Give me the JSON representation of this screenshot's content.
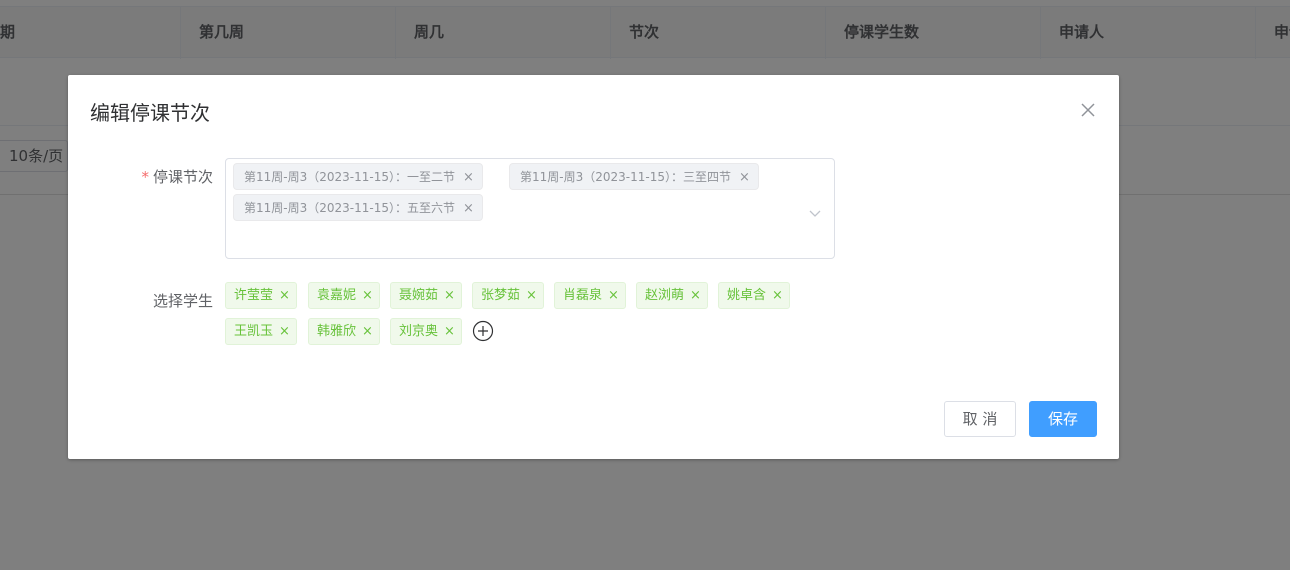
{
  "background": {
    "table_headers": [
      "期",
      "第几周",
      "周几",
      "节次",
      "停课学生数",
      "申请人",
      "申请"
    ],
    "page_size": "10条/页"
  },
  "dialog": {
    "title": "编辑停课节次",
    "close_icon": "close-icon",
    "form": {
      "periods_label": "停课节次",
      "required_mark": "*",
      "selected_periods": [
        "第11周-周3（2023-11-15）：一至二节",
        "第11周-周3（2023-11-15）：三至四节",
        "第11周-周3（2023-11-15）：五至六节"
      ],
      "students_label": "选择学生",
      "students": [
        "许莹莹",
        "袁嘉妮",
        "聂婉茹",
        "张梦茹",
        "肖磊泉",
        "赵浏萌",
        "姚卓含",
        "王凯玉",
        "韩雅欣",
        "刘京奥"
      ],
      "tag_close_symbol": "×",
      "add_icon": "plus-circle-icon",
      "arrow_icon": "chevron-down-icon"
    },
    "buttons": {
      "cancel": "取 消",
      "save": "保存"
    },
    "colors": {
      "primary": "#409eff",
      "success_tag_text": "#67c23a",
      "required": "#f56c6c"
    }
  }
}
